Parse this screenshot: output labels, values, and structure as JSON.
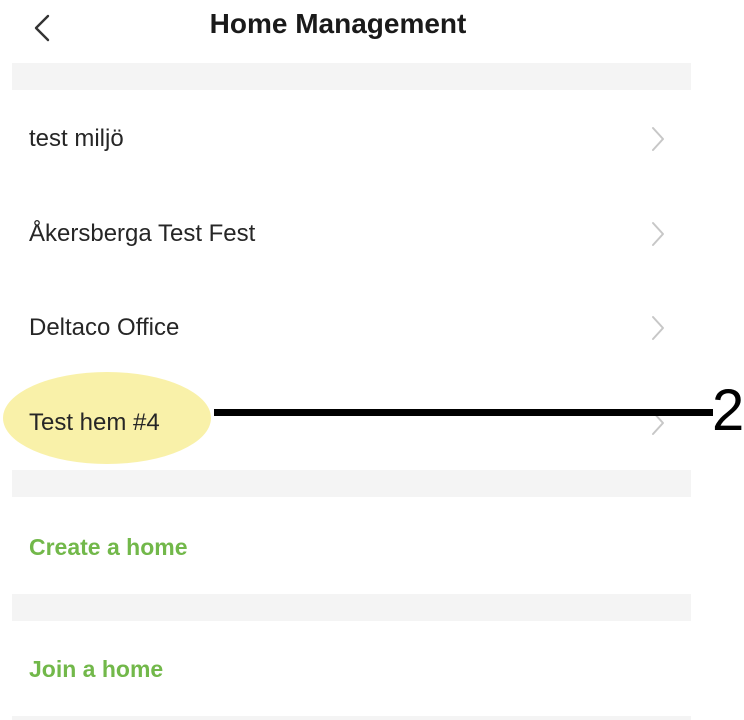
{
  "header": {
    "title": "Home Management",
    "back_icon": "chevron-left-icon"
  },
  "homes": [
    {
      "name": "test miljö"
    },
    {
      "name": "Åkersberga Test Fest"
    },
    {
      "name": "Deltaco Office"
    },
    {
      "name": "Test hem #4"
    }
  ],
  "actions": {
    "create_label": "Create a home",
    "join_label": "Join a home"
  },
  "annotation": {
    "number": "2",
    "highlight_color": "#f8ee9a"
  },
  "colors": {
    "accent_green": "#72b84a",
    "chevron_gray": "#c7c7c7",
    "section_gap": "#f4f4f4"
  }
}
